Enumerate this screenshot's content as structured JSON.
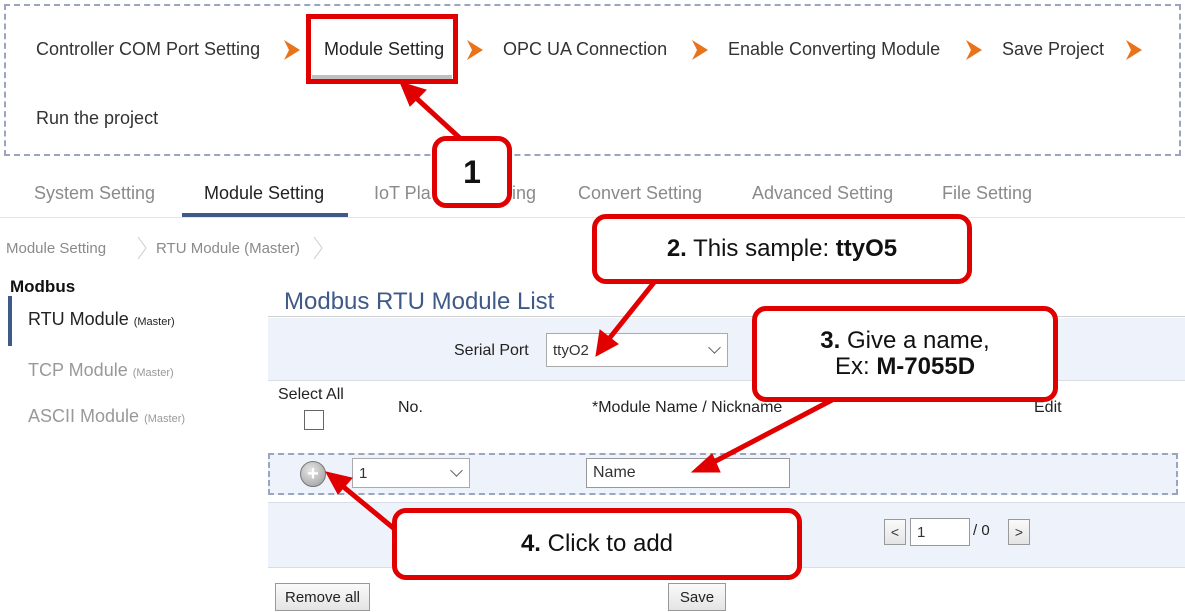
{
  "wizard": {
    "steps": [
      "Controller COM Port Setting",
      "Module Setting",
      "OPC UA Connection",
      "Enable Converting Module",
      "Save Project",
      "Run the project"
    ],
    "active_step": "Module Setting"
  },
  "tabs": [
    "System Setting",
    "Module Setting",
    "IoT Platform Setting",
    "Convert Setting",
    "Advanced Setting",
    "File Setting"
  ],
  "tabs_visible": {
    "iot_left": "IoT Pla",
    "iot_right": "ing"
  },
  "active_tab": "Module Setting",
  "breadcrumb": [
    "Module Setting",
    "RTU Module (Master)"
  ],
  "sidebar": {
    "title": "Modbus",
    "items": [
      {
        "label": "RTU Module",
        "suffix": "(Master)",
        "active": true
      },
      {
        "label": "TCP Module",
        "suffix": "(Master)",
        "active": false
      },
      {
        "label": "ASCII Module",
        "suffix": "(Master)",
        "active": false
      }
    ]
  },
  "main": {
    "title": "Modbus RTU Module List",
    "serial_port_label": "Serial Port",
    "serial_port_value": "ttyO2",
    "select_all_label": "Select All",
    "col_no": "No.",
    "col_name": "*Module Name / Nickname",
    "col_edit": "Edit",
    "add_no_value": "1",
    "add_name_value": "Name",
    "page_current": "1",
    "page_total": "/ 0",
    "prev": "<",
    "next": ">",
    "remove_all": "Remove all",
    "save": "Save"
  },
  "callouts": {
    "c1": "1",
    "c2_num": "2.",
    "c2_text": "This sample:",
    "c2_bold": "ttyO5",
    "c3_num": "3.",
    "c3_text": "Give a name,",
    "c3_line2": "Ex:",
    "c3_bold": "M-7055D",
    "c4_num": "4.",
    "c4_text": "Click to add"
  },
  "colors": {
    "accent": "#3f5a86",
    "callout_border": "#e00000",
    "chevron": "#e8731a"
  }
}
